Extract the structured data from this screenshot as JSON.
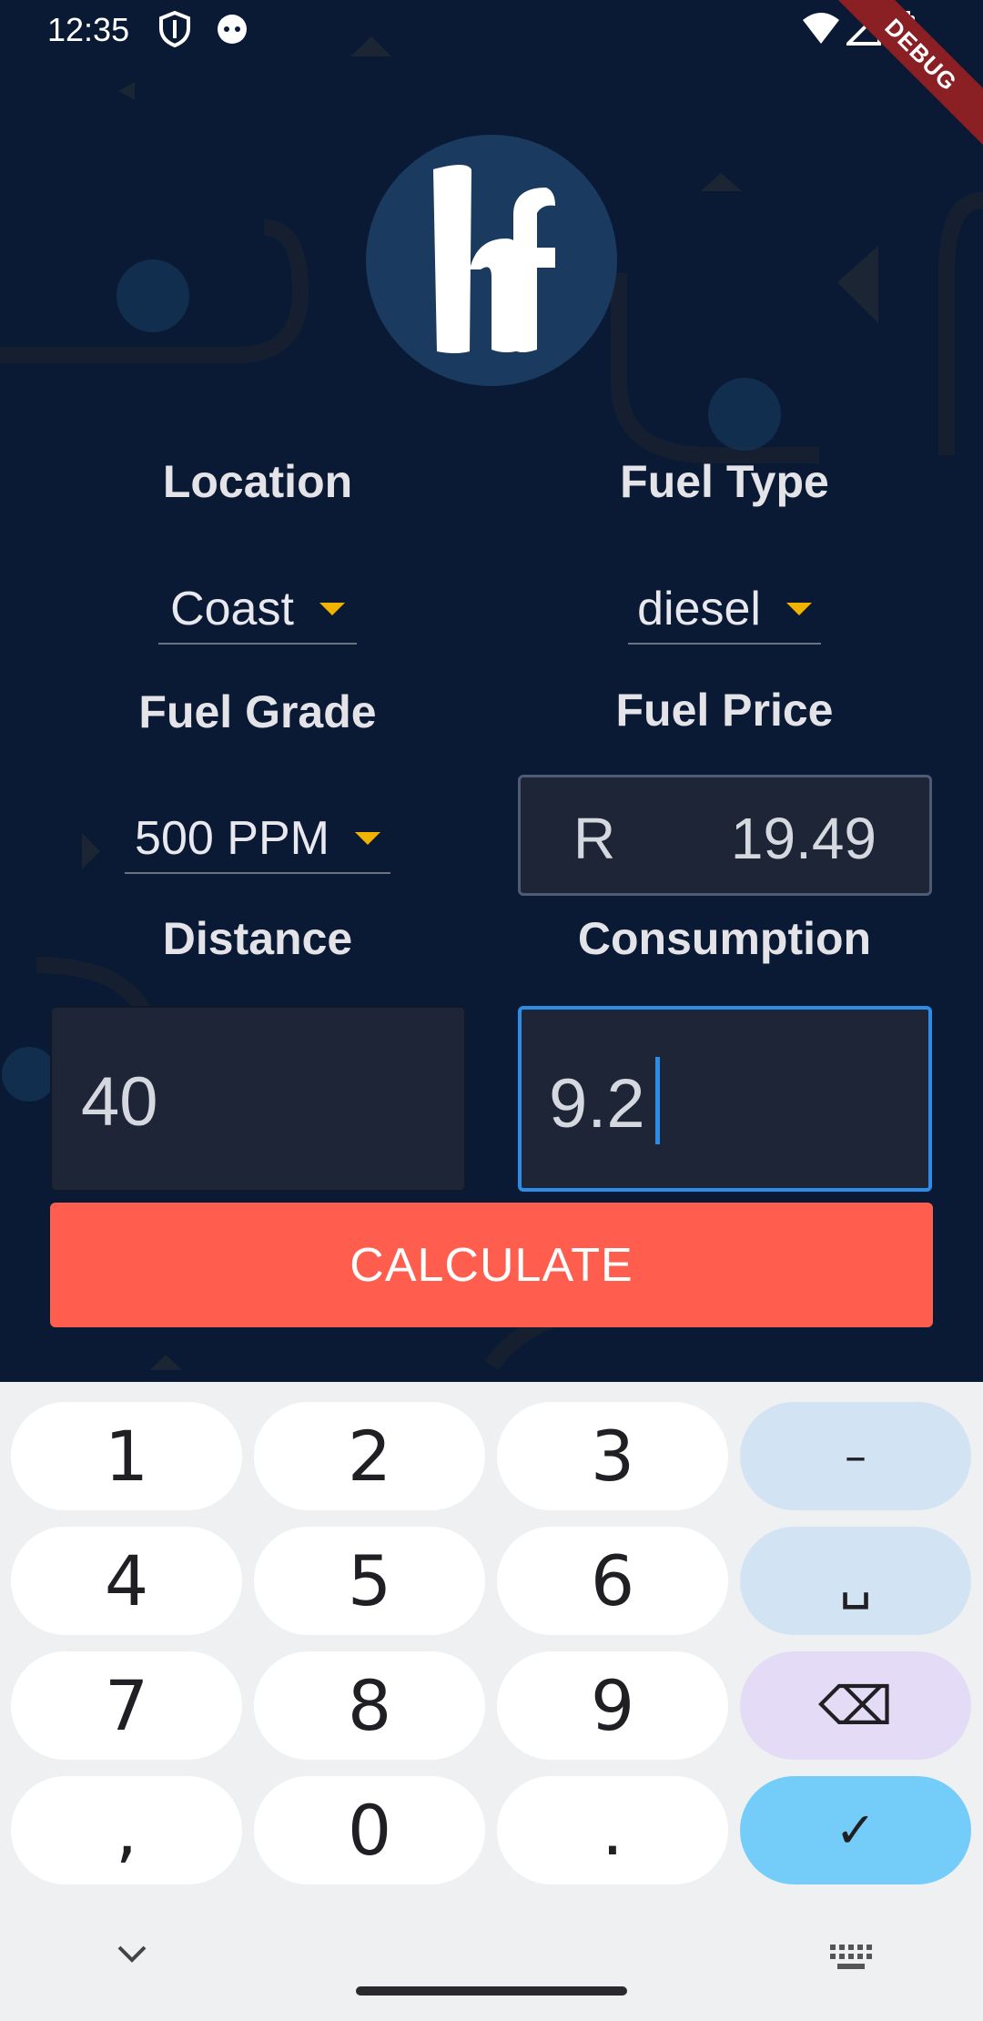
{
  "status_bar": {
    "time": "12:35",
    "debug_label": "DEBUG"
  },
  "logo": {
    "text": "hf"
  },
  "labels": {
    "location": "Location",
    "fuel_type": "Fuel Type",
    "fuel_grade": "Fuel Grade",
    "fuel_price": "Fuel Price",
    "distance": "Distance",
    "consumption": "Consumption"
  },
  "dropdowns": {
    "location": "Coast",
    "fuel_type": "diesel",
    "fuel_grade": "500 PPM"
  },
  "price": {
    "prefix": "R",
    "value": "19.49"
  },
  "inputs": {
    "distance": "40",
    "consumption": "9.2"
  },
  "calculate_label": "CALCULATE",
  "keyboard": {
    "keys": [
      "1",
      "2",
      "3",
      "–",
      "4",
      "5",
      "6",
      "␣",
      "7",
      "8",
      "9",
      "⌫",
      ",",
      "0",
      ".",
      "✓"
    ]
  },
  "colors": {
    "accent_button": "#ff5e4e",
    "dropdown_caret": "#f0b400",
    "focus_border": "#2d8ce6",
    "background": "#0a1a34"
  }
}
